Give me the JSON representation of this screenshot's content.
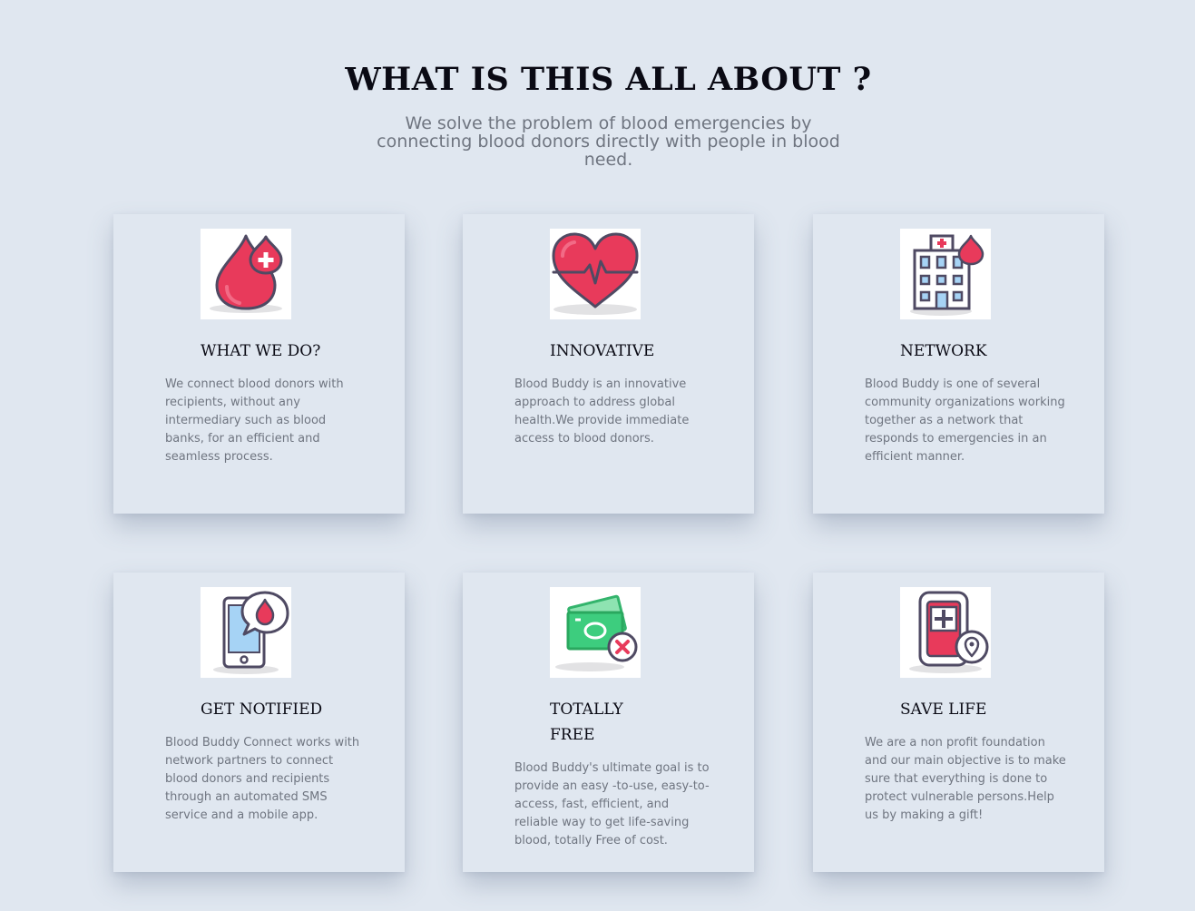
{
  "section": {
    "title": "WHAT IS THIS ALL ABOUT ?",
    "subtitle": "We solve the problem of blood emergencies by connecting blood donors directly with people in blood need."
  },
  "cards": [
    {
      "icon": "blood-drop-plus-icon",
      "title": "WHAT WE DO?",
      "text": "We connect blood donors with recipients, without any intermediary such as blood banks, for an efficient and seamless process."
    },
    {
      "icon": "heart-pulse-icon",
      "title": "INNOVATIVE",
      "text": "Blood Buddy is an innovative approach to address global health.We provide immediate access to blood donors."
    },
    {
      "icon": "hospital-building-icon",
      "title": "NETWORK",
      "text": "Blood Buddy is one of several community organizations working together as a network that responds to emergencies in an efficient manner."
    },
    {
      "icon": "phone-notification-icon",
      "title": "GET NOTIFIED",
      "text": "Blood Buddy Connect works with network partners to connect blood donors and recipients through an automated SMS service and a mobile app."
    },
    {
      "icon": "money-free-icon",
      "title": "TOTALLY FREE",
      "text": "Blood Buddy's ultimate goal is to provide an easy -to-use, easy-to-access, fast, efficient, and reliable way to get life-saving blood, totally Free of cost."
    },
    {
      "icon": "blood-bag-location-icon",
      "title": "SAVE LIFE",
      "text": "We are a non profit foundation and our main objective is to make sure that everything is done to protect vulnerable persons.Help us by making a gift!"
    }
  ],
  "colors": {
    "background": "#e0e7f0",
    "heading": "#0a0a14",
    "body_text": "#6f7580",
    "blood_red": "#e83a5b",
    "outline": "#4f4a63",
    "money_green": "#3dcd7e",
    "phone_screen": "#a6d3f5"
  }
}
